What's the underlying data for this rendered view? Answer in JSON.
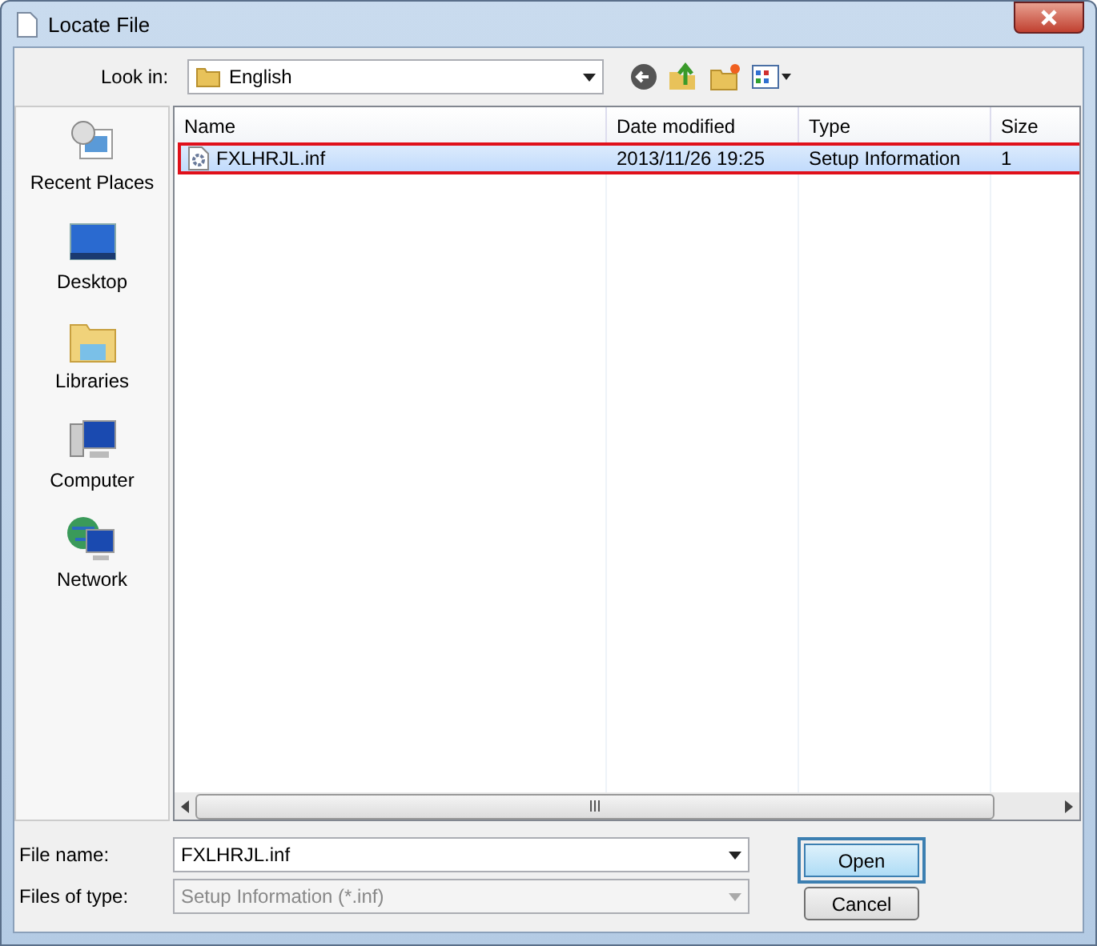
{
  "window": {
    "title": "Locate File"
  },
  "look_in": {
    "label": "Look in:",
    "value": "English"
  },
  "places": [
    {
      "label": "Recent Places",
      "kind": "recent"
    },
    {
      "label": "Desktop",
      "kind": "desktop"
    },
    {
      "label": "Libraries",
      "kind": "libraries"
    },
    {
      "label": "Computer",
      "kind": "computer"
    },
    {
      "label": "Network",
      "kind": "network"
    }
  ],
  "table": {
    "columns": [
      "Name",
      "Date modified",
      "Type",
      "Size"
    ],
    "rows": [
      {
        "cells": [
          "FXLHRJL.inf",
          "2013/11/26 19:25",
          "Setup Information",
          "1"
        ],
        "selected": true,
        "highlighted": true
      }
    ]
  },
  "file_name": {
    "label": "File name:",
    "value": "FXLHRJL.inf"
  },
  "file_type": {
    "label": "Files of type:",
    "value": "Setup Information (*.inf)",
    "disabled": true
  },
  "buttons": [
    {
      "label": "Open",
      "highlighted": true,
      "default": true
    },
    {
      "label": "Cancel",
      "highlighted": false,
      "default": false
    }
  ]
}
